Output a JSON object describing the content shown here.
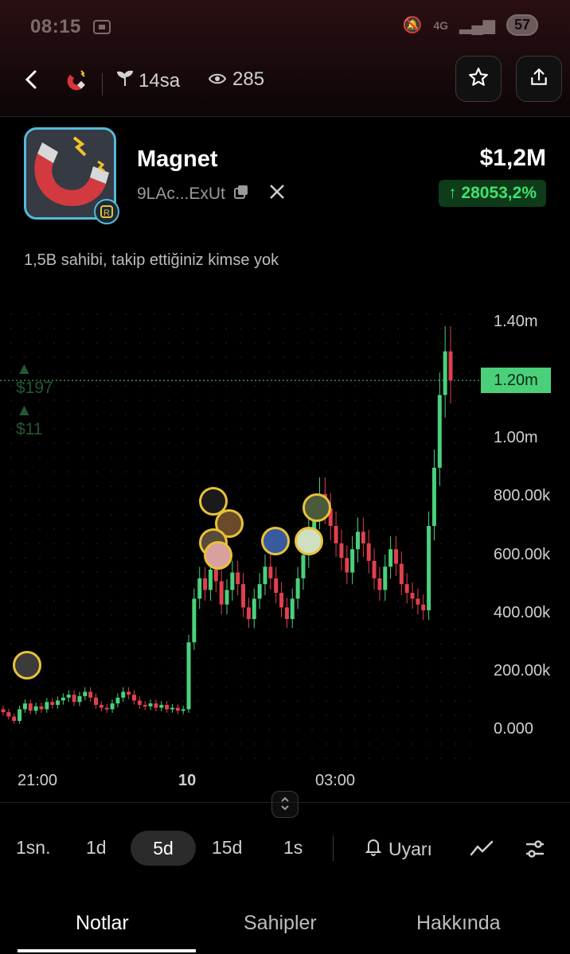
{
  "status_bar": {
    "time": "08:15",
    "network": "4G",
    "battery": "57"
  },
  "nav": {
    "age": "14sa",
    "views": "285"
  },
  "token": {
    "name": "Magnet",
    "address": "9LAc...ExUt",
    "price": "$1,2M",
    "change": "↑ 28053,2%",
    "holders_text": "1,5B sahibi, takip ettiğiniz kimse yok"
  },
  "chart_overlay": {
    "line1": "▲  $197",
    "line2": "▲  $11"
  },
  "chart_data": {
    "type": "candlestick",
    "y_ticks": [
      "1.40m",
      "1.20m",
      "1.00m",
      "800.00k",
      "600.00k",
      "400.00k",
      "200.00k",
      "0.000"
    ],
    "current_label": "1.20m",
    "x_ticks": [
      "21:00",
      "10",
      "03:00"
    ],
    "ylim": [
      0,
      1400000
    ],
    "grid": true,
    "colors": {
      "up": "#4ad07b",
      "down": "#e0404e"
    },
    "close_series": [
      60000,
      45000,
      30000,
      70000,
      90000,
      65000,
      80000,
      70000,
      95000,
      85000,
      100000,
      110000,
      120000,
      95000,
      115000,
      130000,
      110000,
      85000,
      75000,
      70000,
      90000,
      110000,
      130000,
      120000,
      100000,
      85000,
      80000,
      90000,
      75000,
      85000,
      70000,
      75000,
      65000,
      70000,
      300000,
      450000,
      520000,
      480000,
      550000,
      510000,
      430000,
      480000,
      540000,
      500000,
      420000,
      380000,
      450000,
      500000,
      560000,
      520000,
      470000,
      420000,
      380000,
      450000,
      520000,
      600000,
      680000,
      740000,
      810000,
      760000,
      700000,
      640000,
      590000,
      540000,
      620000,
      680000,
      640000,
      580000,
      520000,
      480000,
      560000,
      620000,
      570000,
      500000,
      470000,
      450000,
      430000,
      410000,
      700000,
      900000,
      1150000,
      1300000,
      1200000
    ]
  },
  "controls": {
    "timeframes": [
      "1sn.",
      "1d",
      "5d",
      "15d",
      "1s"
    ],
    "active_timeframe": "5d",
    "alert_label": "Uyarı"
  },
  "tabs": [
    "Notlar",
    "Sahipler",
    "Hakkında"
  ]
}
